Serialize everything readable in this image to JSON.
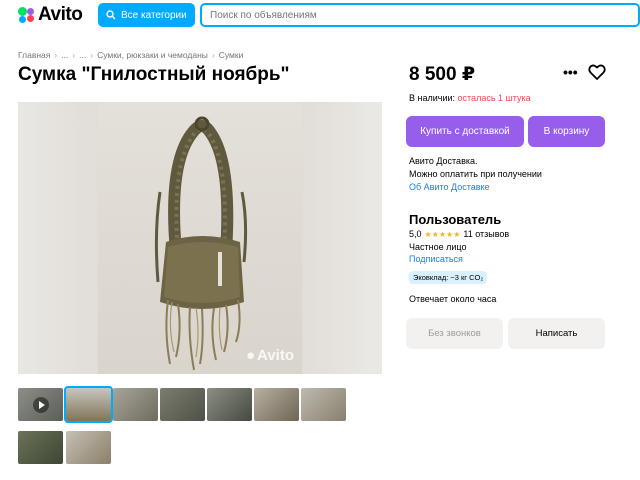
{
  "header": {
    "logo_text": "Avito",
    "categories_label": "Все категории",
    "search_placeholder": "Поиск по объявлениям"
  },
  "breadcrumb": [
    "Главная",
    "...",
    "...",
    "Сумки, рюкзаки и чемоданы",
    "Сумки"
  ],
  "listing": {
    "title": "Сумка \"Гнилостный ноябрь\"",
    "watermark": "Avito",
    "thumb_count": 9,
    "active_thumb": 2
  },
  "sidebar": {
    "price": "8 500 ₽",
    "stock_label": "В наличии:",
    "stock_value": "осталась 1 штука",
    "buy_delivery_label": "Купить с доставкой",
    "cart_label": "В корзину",
    "delivery_line1": "Авито Доставка.",
    "delivery_line2": "Можно оплатить при получении",
    "delivery_link": "Об Авито Доставке",
    "seller_name": "Пользователь",
    "rating_value": "5,0",
    "rating_stars": 5,
    "reviews": "11 отзывов",
    "seller_type": "Частное лицо",
    "subscribe": "Подписаться",
    "eco_badge": "Эковклад: ~3 кг CO₂",
    "responds": "Отвечает около часа",
    "no_calls_label": "Без звонков",
    "write_label": "Написать"
  },
  "colors": {
    "accent_blue": "#00aaff",
    "buy_purple": "#965eeb",
    "stock_red": "#ff4053",
    "link_blue": "#0a85ff",
    "star_yellow": "#ffb021"
  }
}
